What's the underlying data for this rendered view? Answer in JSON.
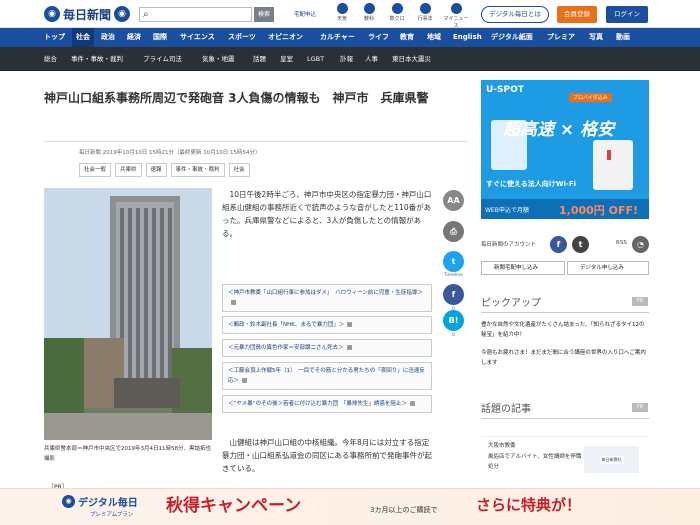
{
  "header": {
    "logo_text": "毎日新聞",
    "search_button": "検索",
    "home_delivery": "宅配申込",
    "icons": [
      {
        "label": "天気",
        "icon": "weather-icon"
      },
      {
        "label": "教科",
        "icon": "book-icon"
      },
      {
        "label": "数クロ",
        "icon": "puzzle-icon"
      },
      {
        "label": "行事法",
        "icon": "calendar-icon"
      },
      {
        "label": "マイニュース",
        "icon": "bookmark-icon"
      }
    ],
    "digital_link": "デジタル毎日とは",
    "register": "会員登録",
    "login": "ログイン"
  },
  "nav_primary": [
    "トップ",
    "社会",
    "政治",
    "経済",
    "国際",
    "サイエンス",
    "スポーツ",
    "オピニオン",
    "カルチャー",
    "ライフ",
    "教育",
    "地域",
    "English",
    "デジタル紙面",
    "プレミア",
    "写真",
    "動画"
  ],
  "nav_primary_active": "社会",
  "nav_secondary": [
    "総合",
    "事件・事故・裁判",
    "プライム司法",
    "気象・地震",
    "話題",
    "皇室",
    "LGBT",
    "訃報",
    "人事",
    "東日本大震災"
  ],
  "article": {
    "title": "神戸山口組系事務所周辺で発砲音 3人負傷の情報も　神戸市　兵庫県警",
    "meta": "毎日新聞 2019年10月10日 15時21分（最終更新 10月10日 15時54分）",
    "tags": [
      "社会一般",
      "兵庫県",
      "速報",
      "事件・事故・裁判",
      "社会"
    ],
    "photo_caption": "兵庫県警本部＝神戸市中央区で2019年3月4日11時58分、黒詰拓也撮影",
    "pr_label": "［PR］",
    "paragraph1": "10日午後2時半ごろ、神戸市中央区の指定暴力団・神戸山口組系山健組の事務所近くで銃声のような音がしたと110番があった。兵庫県警などによると、3人が負傷したとの情報がある。",
    "related": [
      "＜神戸市教委「山口組行事に参加はダメ」　ハロウィーン前に児童・生徒指導＞",
      "＜郵政・鈴木副社長「NHK、まるで暴力団」＞",
      "＜元暴力団員の異色作家＝安部譲二さん死去＞",
      "＜工藤会頂上作戦5年（1）　一目でその筋と分かる男たちの「夜回り」に迅速反応＞",
      "＜“ヤメ暴”のその後＞若者に付け込む暴力団　「暴排先生」誘惑を阻止＞"
    ],
    "paragraph2": "山健組は神戸山口組の中核組織。今年8月には対立する指定暴力団・山口組系弘道会の同区にある事務所前で発砲事件が起きている。"
  },
  "share": {
    "font_label": "AA",
    "timeline_label": "Timeline",
    "fb_count": "0",
    "b_count": "0"
  },
  "ad": {
    "title": "U-SPOT",
    "badge": "プロバイダ込み",
    "main_left": "超高速",
    "main_right": "格安",
    "wifi_text": "すぐに使える法人向けWi-Fi",
    "footer_left": "WEB申込で月額",
    "footer_price": "1,000円 OFF!"
  },
  "sidebar": {
    "follow_label": "毎日新聞のアカウント",
    "rss_label": "RSS",
    "home_delivery_button": "新聞宅配申し込み",
    "digital_button": "デジタル申し込み",
    "pickup_title": "ピックアップ",
    "pr_badge": "PR",
    "pickup_items": [
      "豊かな自然や文化遺産がたくさん詰まった、「知られざるタイ12の秘宝」を紹介中！",
      "今週もお疲れさま！まだまだ間に合う講座の世界の入り口へご案内します"
    ],
    "topics_title": "話題の記事",
    "topic_head": "大阪市教委",
    "topic_text": "風俗店でアルバイト、女性講師を停職処分",
    "topic_img_text": "毎日新聞社"
  },
  "banner": {
    "logo_text": "デジタル毎日",
    "plan_text": "プレミアムプラン",
    "main_text": "秋得キャンペーン",
    "sub_text": "3カ月以上のご購読で",
    "sub_text2": "さらに特典が！"
  },
  "colors": {
    "brand": "#1a4e9e",
    "nav_dark": "#2b2f36",
    "accent_orange": "#e8701a",
    "campaign_red": "#c8202a"
  }
}
